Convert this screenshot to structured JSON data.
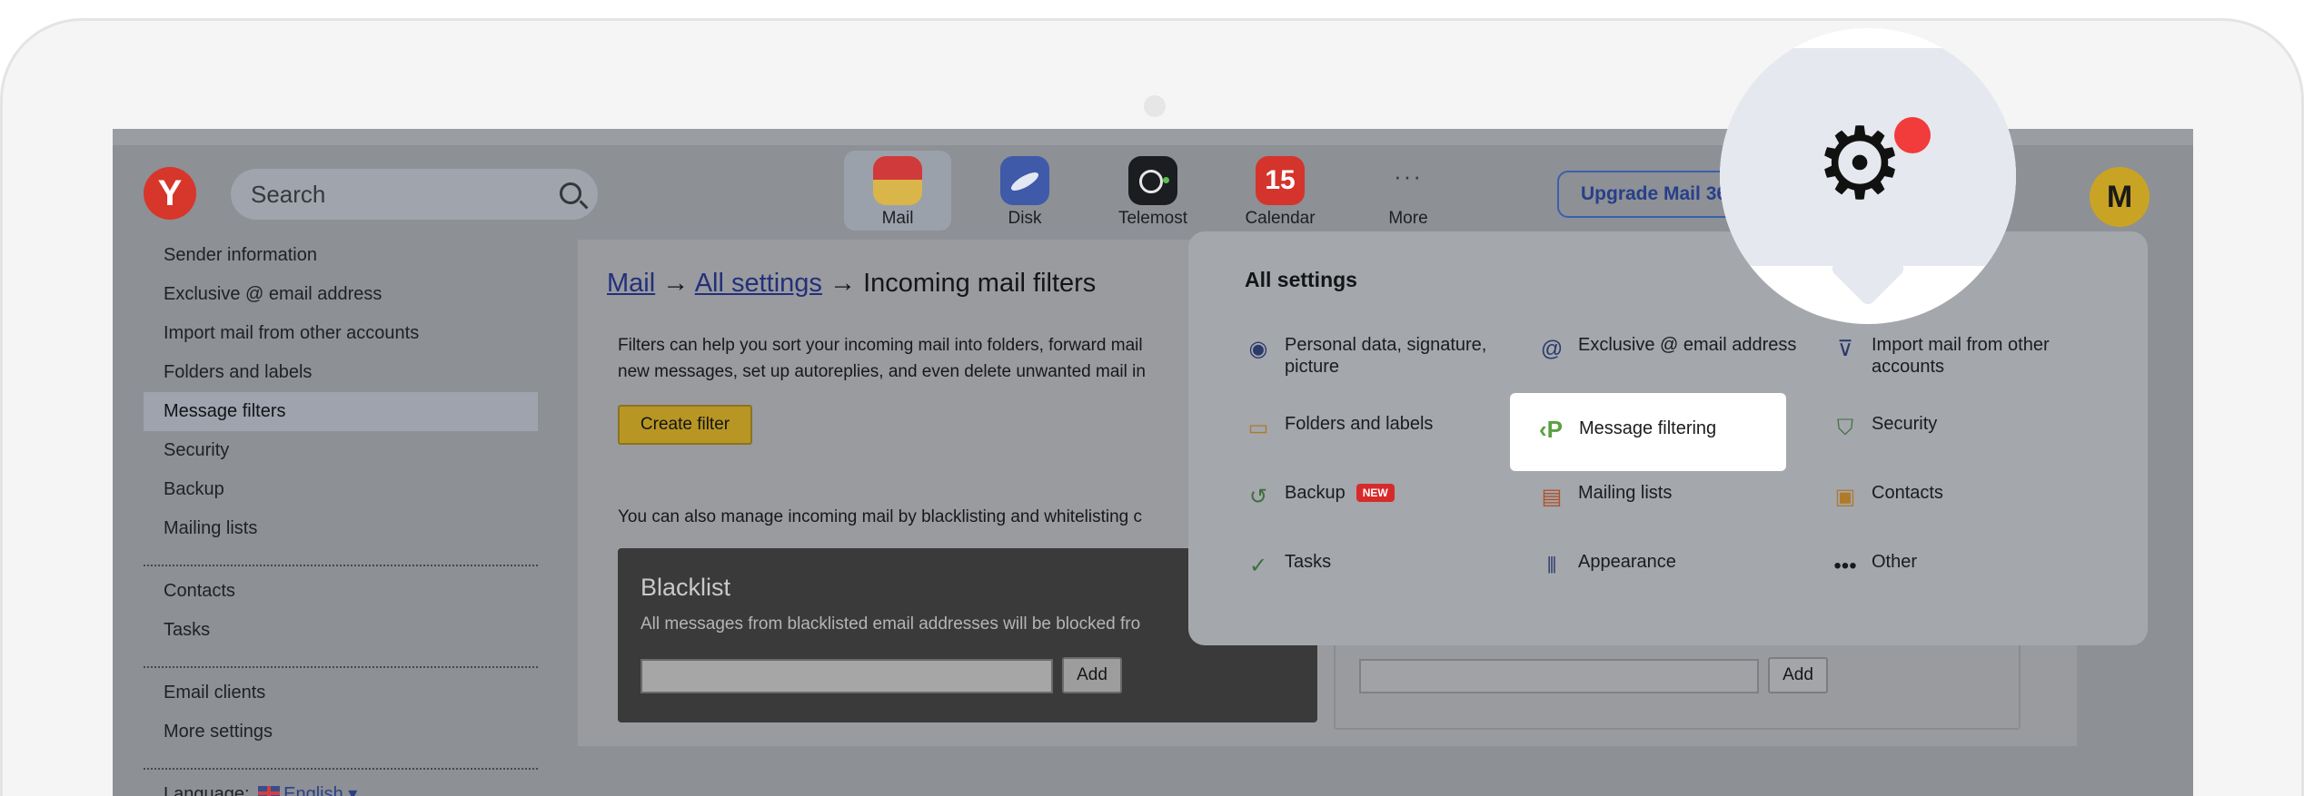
{
  "header": {
    "logo": "Y",
    "search_placeholder": "Search",
    "apps": [
      {
        "label": "Mail",
        "icon": "mail-icon"
      },
      {
        "label": "Disk",
        "icon": "disk-icon"
      },
      {
        "label": "Telemost",
        "icon": "telemost-icon"
      },
      {
        "label": "Calendar",
        "icon": "calendar-icon",
        "icon_text": "15"
      },
      {
        "label": "More",
        "icon": "more-icon",
        "icon_text": "···"
      }
    ],
    "upgrade_label": "Upgrade Mail 36",
    "avatar_initial": "M"
  },
  "sidebar": {
    "group1": [
      "Sender information",
      "Exclusive @ email address",
      "Import mail from other accounts",
      "Folders and labels",
      "Message filters",
      "Security",
      "Backup",
      "Mailing lists"
    ],
    "selected": "Message filters",
    "group2": [
      "Contacts",
      "Tasks"
    ],
    "group3": [
      "Email clients",
      "More settings"
    ],
    "language_label": "Language:",
    "language_value": "English"
  },
  "content": {
    "breadcrumb": {
      "mail": "Mail",
      "arrow1": "→",
      "all_settings": "All settings",
      "arrow2": "→",
      "current": "Incoming mail filters"
    },
    "desc_line1": "Filters can help you sort your incoming mail into folders, forward mail",
    "desc_line2": "new messages, set up autoreplies, and even delete unwanted mail in",
    "create_filter": "Create filter",
    "manage_text": "You can also manage incoming mail by blacklisting and whitelisting c",
    "blacklist": {
      "title": "Blacklist",
      "text": "All messages from blacklisted email addresses will be blocked fro",
      "add": "Add"
    },
    "whitelist": {
      "add": "Add"
    }
  },
  "settings_panel": {
    "title": "All settings",
    "items": [
      {
        "label": "Personal data, signature, picture",
        "icon": "person-icon"
      },
      {
        "label": "Exclusive @ email address",
        "icon": "at-icon"
      },
      {
        "label": "Import mail from other accounts",
        "icon": "import-icon"
      },
      {
        "label": "Folders and labels",
        "icon": "folder-icon"
      },
      {
        "label": "Message filtering",
        "icon": "filter-icon"
      },
      {
        "label": "Security",
        "icon": "shield-icon"
      },
      {
        "label": "Backup",
        "icon": "backup-icon",
        "badge": "NEW"
      },
      {
        "label": "Mailing lists",
        "icon": "mailing-list-icon"
      },
      {
        "label": "Contacts",
        "icon": "contacts-icon"
      },
      {
        "label": "Tasks",
        "icon": "tasks-icon"
      },
      {
        "label": "Appearance",
        "icon": "appearance-icon"
      },
      {
        "label": "Other",
        "icon": "more-dots-icon"
      }
    ]
  },
  "magnifier": {
    "icon": "gear-icon",
    "has_notification_dot": true
  },
  "colors": {
    "accent_red": "#d72b2b",
    "brand_yellow": "#b89623",
    "link_blue": "#23307a",
    "filter_green": "#5aa040"
  }
}
